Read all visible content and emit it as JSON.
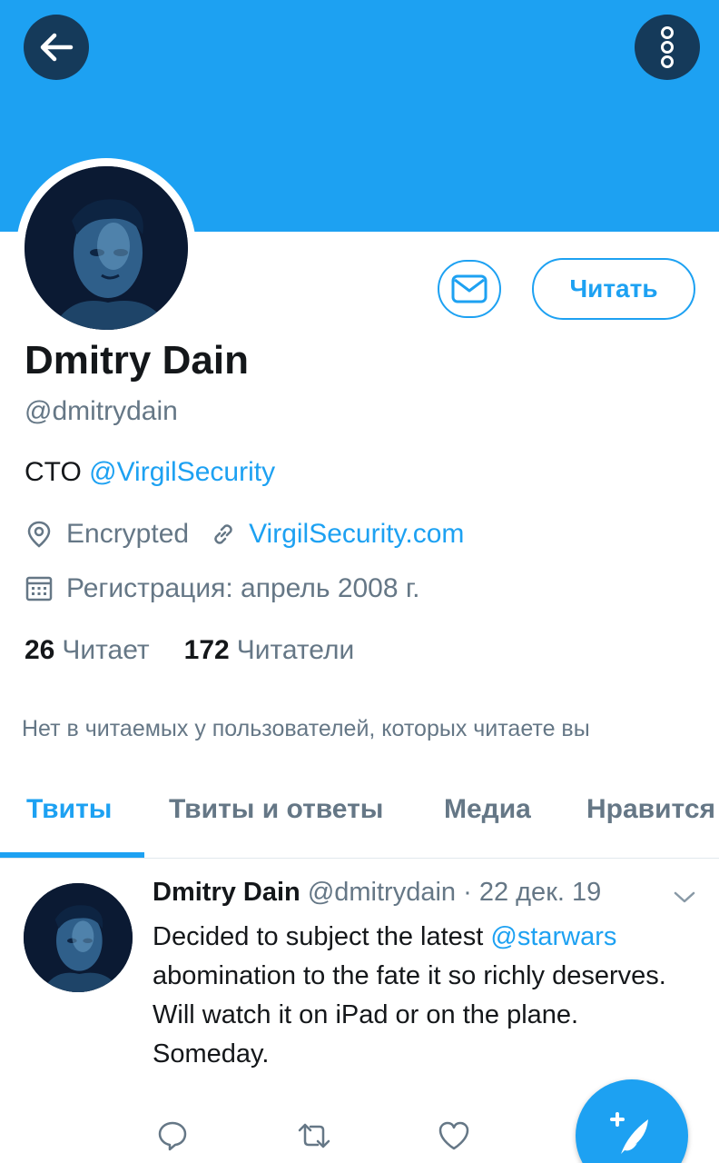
{
  "header": {
    "back_icon": "arrow-left-icon",
    "more_icon": "more-vertical-icon",
    "banner_color": "#1da1f2"
  },
  "profile": {
    "name": "Dmitry Dain",
    "handle": "@dmitrydain",
    "bio_prefix": "CTO ",
    "bio_mention": "@VirgilSecurity",
    "location": "Encrypted",
    "website": "VirgilSecurity.com",
    "joined": "Регистрация: апрель 2008 г.",
    "following_count": "26",
    "following_label": "Читает",
    "followers_count": "172",
    "followers_label": "Читатели",
    "not_followed_text": "Нет в читаемых у пользователей, которых читаете вы"
  },
  "actions": {
    "message_icon": "envelope-icon",
    "follow_label": "Читать"
  },
  "tabs": [
    {
      "label": "Твиты",
      "active": true
    },
    {
      "label": "Твиты и ответы",
      "active": false
    },
    {
      "label": "Медиа",
      "active": false
    },
    {
      "label": "Нравится",
      "active": false
    }
  ],
  "tweet": {
    "author_name": "Dmitry Dain",
    "author_handle": "@dmitrydain",
    "date": "· 22 дек. 19",
    "text_before": "Decided to subject the latest ",
    "mention": "@starwars",
    "text_after": " abomination to the fate it so richly deserves. Will watch it on iPad or on the plane. Someday."
  },
  "colors": {
    "accent": "#1da1f2",
    "secondary_text": "#657786",
    "primary_text": "#14171a"
  }
}
